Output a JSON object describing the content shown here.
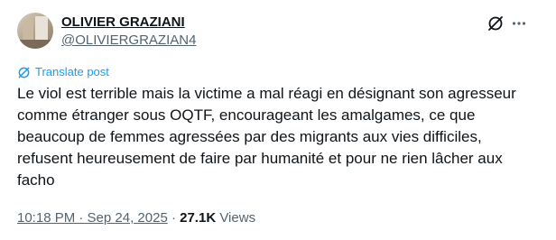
{
  "author": {
    "display_name": "OLIVIER GRAZIANI",
    "handle": "@OLIVIERGRAZIAN4"
  },
  "translate_label": "Translate post",
  "post_text": {
    "lines": [
      "Le viol est terrible mais la victime a mal réagi en désignant son agresseur",
      "comme étranger sous OQTF, encourageant les amalgames, ce que",
      "beaucoup de femmes agressées par des migrants aux vies difficiles,",
      "refusent heureusement de faire par humanité et pour ne rien lâcher aux",
      "facho"
    ]
  },
  "meta": {
    "time": "10:18 PM · Sep 24, 2025",
    "separator": " · ",
    "views_count": "27.1K",
    "views_label": " Views"
  },
  "icons": {
    "grok": "grok-icon",
    "more": "more-icon",
    "translate": "translate-icon"
  },
  "colors": {
    "text": "#0f1419",
    "secondary": "#536471",
    "link": "#1d9bf0"
  }
}
